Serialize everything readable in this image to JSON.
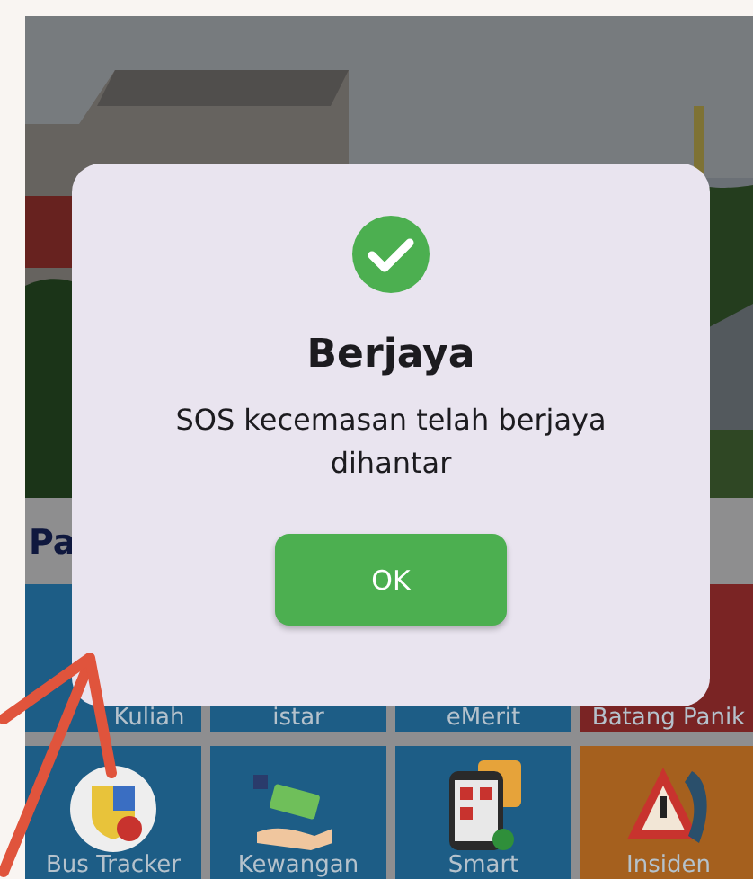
{
  "section": {
    "title": "Pa"
  },
  "tiles": [
    {
      "label": "Kuliah",
      "kind": "none",
      "color": "#1d5d86"
    },
    {
      "label": "istar",
      "kind": "none",
      "color": "#1d5d86"
    },
    {
      "label": "eMerit",
      "kind": "none",
      "color": "#1d5d86"
    },
    {
      "label": "Batang Panik",
      "kind": "none",
      "color": "#7a2424"
    },
    {
      "label": "Bus Tracker",
      "kind": "crest",
      "color": "#1d5d86"
    },
    {
      "label": "Kewangan",
      "kind": "money",
      "color": "#1d5d86"
    },
    {
      "label": "Smart",
      "kind": "phone",
      "color": "#1d5d86"
    },
    {
      "label": "Insiden",
      "kind": "warning",
      "color": "#a5601e"
    }
  ],
  "dialog": {
    "kind": "success",
    "title": "Berjaya",
    "message": "SOS kecemasan telah berjaya dihantar",
    "button": "OK"
  },
  "annotation": {
    "kind": "arrow"
  }
}
